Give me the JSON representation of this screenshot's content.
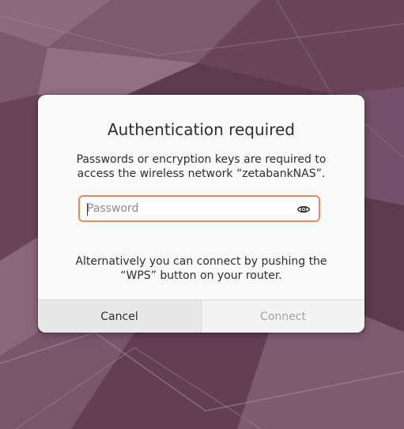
{
  "dialog": {
    "title": "Authentication required",
    "message_line1": "Passwords or encryption keys are required to",
    "message_line2": "access the wireless network “zetabankNAS”.",
    "password": {
      "placeholder": "Password",
      "value": "",
      "reveal_icon": "eye-icon"
    },
    "alt_line1": "Alternatively you can connect by pushing the",
    "alt_line2": "“WPS” button on your router.",
    "cancel_label": "Cancel",
    "connect_label": "Connect",
    "connect_enabled": false
  },
  "colors": {
    "focus_ring": "#e9885f",
    "dialog_bg": "#fafafa",
    "wallpaper": "#6f4a5e"
  }
}
